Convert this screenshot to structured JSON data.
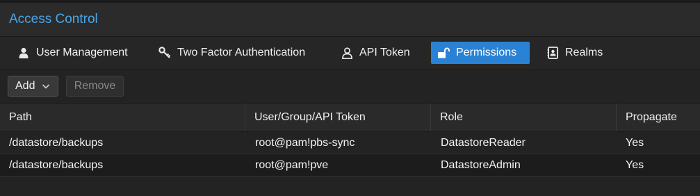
{
  "header": {
    "title": "Access Control"
  },
  "tabs": [
    {
      "label": "User Management",
      "icon": "user-icon"
    },
    {
      "label": "Two Factor Authentication",
      "icon": "key-icon"
    },
    {
      "label": "API Token",
      "icon": "user-outline-icon"
    },
    {
      "label": "Permissions",
      "icon": "unlock-icon",
      "active": true
    },
    {
      "label": "Realms",
      "icon": "address-book-icon"
    }
  ],
  "toolbar": {
    "add_label": "Add",
    "remove_label": "Remove"
  },
  "table": {
    "columns": [
      "Path",
      "User/Group/API Token",
      "Role",
      "Propagate"
    ],
    "rows": [
      {
        "path": "/datastore/backups",
        "user": "root@pam!pbs-sync",
        "role": "DatastoreReader",
        "propagate": "Yes"
      },
      {
        "path": "/datastore/backups",
        "user": "root@pam!pve",
        "role": "DatastoreAdmin",
        "propagate": "Yes"
      }
    ]
  },
  "colors": {
    "accent": "#2a82d4",
    "title": "#4aa6ea",
    "background": "#232323"
  }
}
